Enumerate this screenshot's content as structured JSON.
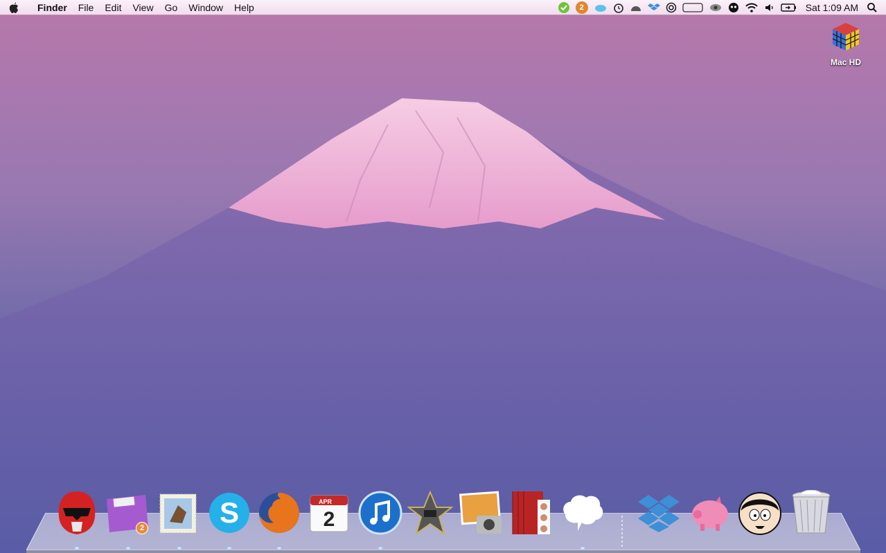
{
  "menubar": {
    "app_name": "Finder",
    "menus": [
      "File",
      "Edit",
      "View",
      "Go",
      "Window",
      "Help"
    ],
    "status_items": [
      "evernote-icon",
      "notification-badge",
      "cloud-icon",
      "alarm-clock-icon",
      "dome-icon",
      "dropbox-status-icon",
      "target-icon",
      "blank-rect-icon",
      "eye-icon",
      "face-icon",
      "wifi-icon",
      "volume-icon",
      "battery-icon"
    ],
    "notification_count": "2",
    "clock": "Sat 1:09 AM"
  },
  "desktop": {
    "drive_label": "Mac HD"
  },
  "dock": {
    "items": [
      {
        "name": "power-ranger-helmet-icon"
      },
      {
        "name": "purple-folder-icon",
        "badge": "2"
      },
      {
        "name": "mail-stamp-icon"
      },
      {
        "name": "skype-icon"
      },
      {
        "name": "firefox-icon"
      },
      {
        "name": "calendar-icon",
        "month": "APR",
        "day": "2"
      },
      {
        "name": "itunes-icon"
      },
      {
        "name": "imovie-icon"
      },
      {
        "name": "iphoto-icon"
      },
      {
        "name": "photo-booth-icon"
      },
      {
        "name": "speech-bubble-icon"
      },
      {
        "name": "dropbox-icon"
      },
      {
        "name": "piggy-bank-icon"
      },
      {
        "name": "cartoon-face-icon"
      },
      {
        "name": "trash-icon"
      }
    ]
  }
}
